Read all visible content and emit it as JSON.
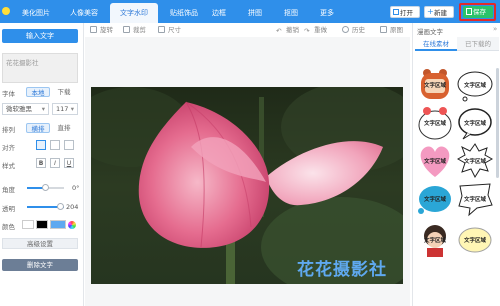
{
  "colors": {
    "primary": "#2f8fea",
    "save": "#2ac36a",
    "highlight_box": "#e12a2a",
    "watermark": "#5fa9f0"
  },
  "nav": {
    "tabs": [
      {
        "label": "美化图片"
      },
      {
        "label": "人像美容"
      },
      {
        "label": "文字水印",
        "active": true
      },
      {
        "label": "贴纸饰品"
      },
      {
        "label": "边框"
      },
      {
        "label": "拼图"
      },
      {
        "label": "抠图"
      },
      {
        "label": "更多"
      }
    ],
    "open_label": "打开",
    "new_label": "新建",
    "save_label": "保存"
  },
  "left_panel": {
    "add_text_label": "输入文字",
    "text_value": "花花摄影社",
    "font_label": "字体",
    "font_local": "本地",
    "font_download": "下载",
    "font_name": "微软雅黑",
    "font_size": "117",
    "layout_label": "排列",
    "horizontal": "横排",
    "vertical": "直排",
    "align_label": "对齐",
    "style_label": "样式",
    "style_bold": "B",
    "style_italic": "I",
    "style_underline": "U",
    "angle_label": "角度",
    "angle_value": "0°",
    "opacity_label": "透明",
    "opacity_value": "204",
    "color_label": "颜色",
    "advanced_label": "高级设置",
    "delete_label": "删除文字"
  },
  "toolbar": {
    "rotate": "旋转",
    "crop": "裁剪",
    "size": "尺寸",
    "undo": "撤销",
    "redo": "重做",
    "history": "历史",
    "original": "原图"
  },
  "canvas": {
    "watermark_text": "花花摄影社"
  },
  "right_panel": {
    "title": "漫画文字",
    "tab_online": "在线素材",
    "tab_downloaded": "已下载的",
    "stickers": [
      {
        "name": "bear-text-bubble",
        "label": "文字区域"
      },
      {
        "name": "cloud-text-bubble",
        "label": "文字区域"
      },
      {
        "name": "cow-text-bubble",
        "label": "文字区域"
      },
      {
        "name": "round-text-bubble",
        "label": "文字区域"
      },
      {
        "name": "heart-text-bubble",
        "label": "文字区域"
      },
      {
        "name": "spiky-text-bubble",
        "label": "文字区域"
      },
      {
        "name": "blue-splash-bubble",
        "label": "文字区域"
      },
      {
        "name": "jagged-text-bubble",
        "label": "文字区域"
      },
      {
        "name": "character-bubble",
        "label": "文字区域"
      },
      {
        "name": "yellow-cloud-bubble",
        "label": "文字区域"
      }
    ]
  }
}
